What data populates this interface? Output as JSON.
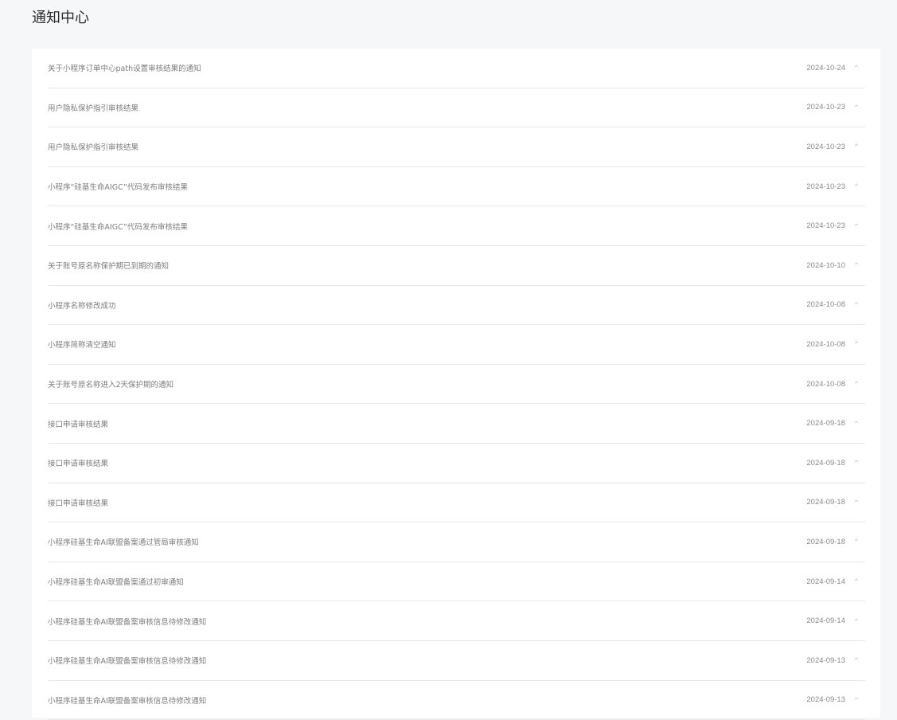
{
  "page": {
    "title": "通知中心"
  },
  "notifications": [
    {
      "title": "关于小程序订单中心path设置审核结果的通知",
      "date": "2024-10-24"
    },
    {
      "title": "用户隐私保护指引审核结果",
      "date": "2024-10-23"
    },
    {
      "title": "用户隐私保护指引审核结果",
      "date": "2024-10-23"
    },
    {
      "title": "小程序“硅基生命AIGC”代码发布审核结果",
      "date": "2024-10-23"
    },
    {
      "title": "小程序“硅基生命AIGC”代码发布审核结果",
      "date": "2024-10-23"
    },
    {
      "title": "关于账号原名称保护期已到期的通知",
      "date": "2024-10-10"
    },
    {
      "title": "小程序名称修改成功",
      "date": "2024-10-08"
    },
    {
      "title": "小程序简称清空通知",
      "date": "2024-10-08"
    },
    {
      "title": "关于账号原名称进入2天保护期的通知",
      "date": "2024-10-08"
    },
    {
      "title": "接口申请审核结果",
      "date": "2024-09-18"
    },
    {
      "title": "接口申请审核结果",
      "date": "2024-09-18"
    },
    {
      "title": "接口申请审核结果",
      "date": "2024-09-18"
    },
    {
      "title": "小程序硅基生命AI联盟备案通过管局审核通知",
      "date": "2024-09-18"
    },
    {
      "title": "小程序硅基生命AI联盟备案通过初审通知",
      "date": "2024-09-14"
    },
    {
      "title": "小程序硅基生命AI联盟备案审核信息待修改通知",
      "date": "2024-09-14"
    },
    {
      "title": "小程序硅基生命AI联盟备案审核信息待修改通知",
      "date": "2024-09-13"
    },
    {
      "title": "小程序硅基生命AI联盟备案审核信息待修改通知",
      "date": "2024-09-13"
    }
  ],
  "icons": {
    "row_expand": "chevron-up-icon"
  },
  "colors": {
    "background": "#f6f7f9",
    "panel": "#ffffff",
    "divider": "#e7e7e9",
    "text_muted": "#7d7d7d"
  }
}
